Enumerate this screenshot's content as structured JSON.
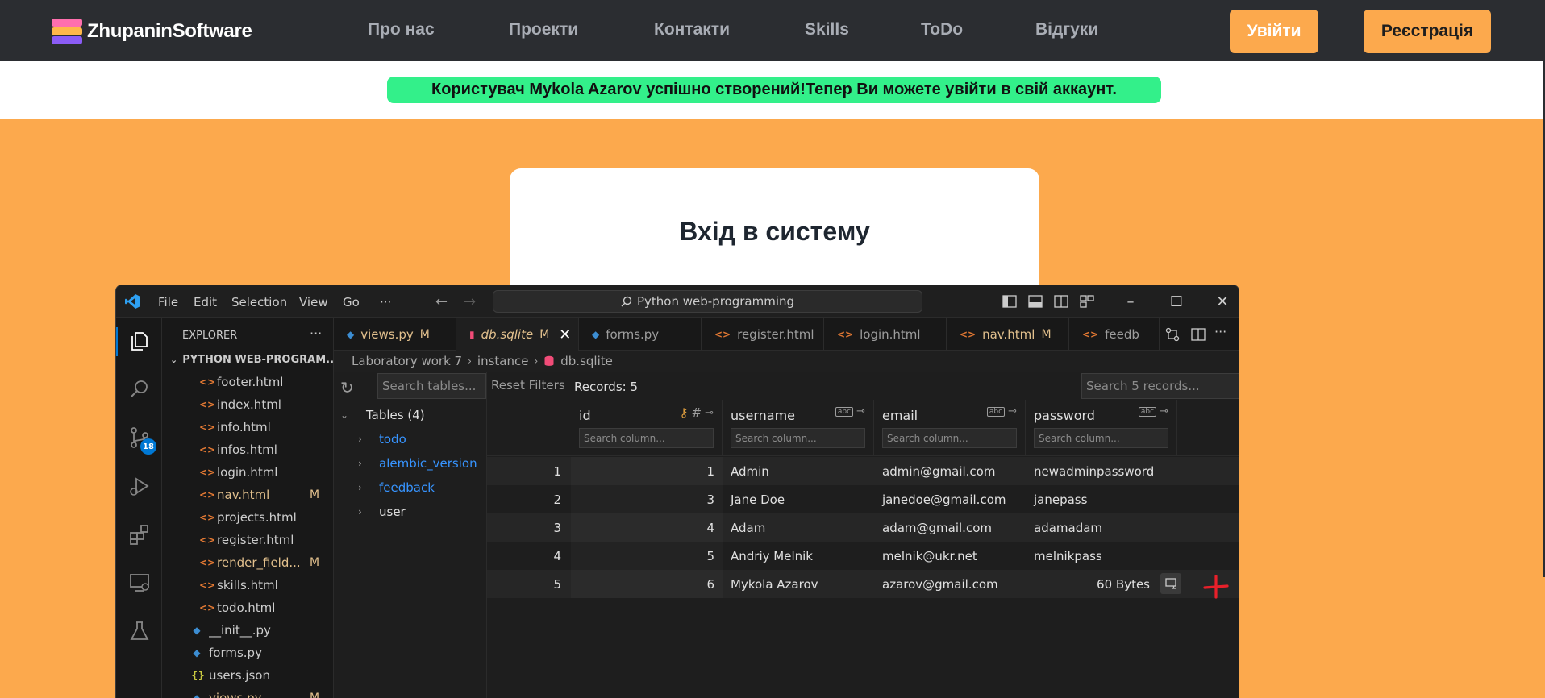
{
  "site": {
    "brand": "ZhupaninSoftware",
    "nav_links": [
      "Про нас",
      "Проекти",
      "Контакти",
      "Skills",
      "ToDo",
      "Відгуки"
    ],
    "login_button": "Увійти",
    "register_button": "Реєстрація",
    "flash_message": "Користувач Mykola Azarov успішно створений!Тепер Ви можете увійти в свій аккаунт.",
    "login_title": "Вхід в систему",
    "colors": {
      "accent": "#fca94d",
      "nav_bg": "#2b2d31",
      "flash_bg": "#33f08a"
    }
  },
  "vscode": {
    "menu": [
      "File",
      "Edit",
      "Selection",
      "View",
      "Go",
      "···"
    ],
    "command_center": "Python web-programming",
    "activity_badge": "18",
    "explorer": {
      "title": "EXPLORER",
      "more": "···",
      "project": "PYTHON WEB-PROGRAM...",
      "files": [
        {
          "name": "footer.html",
          "icon": "html-icon",
          "status": "",
          "modified": false
        },
        {
          "name": "index.html",
          "icon": "html-icon",
          "status": "",
          "modified": false
        },
        {
          "name": "info.html",
          "icon": "html-icon",
          "status": "",
          "modified": false
        },
        {
          "name": "infos.html",
          "icon": "html-icon",
          "status": "",
          "modified": false
        },
        {
          "name": "login.html",
          "icon": "html-icon",
          "status": "",
          "modified": false
        },
        {
          "name": "nav.html",
          "icon": "html-icon",
          "status": "M",
          "modified": true
        },
        {
          "name": "projects.html",
          "icon": "html-icon",
          "status": "",
          "modified": false
        },
        {
          "name": "register.html",
          "icon": "html-icon",
          "status": "",
          "modified": false
        },
        {
          "name": "render_field...",
          "icon": "html-icon",
          "status": "M",
          "modified": true
        },
        {
          "name": "skills.html",
          "icon": "html-icon",
          "status": "",
          "modified": false
        },
        {
          "name": "todo.html",
          "icon": "html-icon",
          "status": "",
          "modified": false
        },
        {
          "name": "__init__.py",
          "icon": "python-icon",
          "status": "",
          "modified": false
        },
        {
          "name": "forms.py",
          "icon": "python-icon",
          "status": "",
          "modified": false
        },
        {
          "name": "users.json",
          "icon": "json-icon",
          "status": "",
          "modified": false
        },
        {
          "name": "views.py",
          "icon": "python-icon",
          "status": "M",
          "modified": true
        }
      ]
    },
    "tabs": [
      {
        "label": "views.py",
        "mark": "M",
        "icon": "python-icon",
        "state": "modified"
      },
      {
        "label": "db.sqlite",
        "mark": "M",
        "icon": "database-icon",
        "state": "active",
        "close": "✕"
      },
      {
        "label": "forms.py",
        "mark": "",
        "icon": "python-icon",
        "state": "normal"
      },
      {
        "label": "register.html",
        "mark": "",
        "icon": "html-icon",
        "state": "normal"
      },
      {
        "label": "login.html",
        "mark": "",
        "icon": "html-icon",
        "state": "normal"
      },
      {
        "label": "nav.html",
        "mark": "M",
        "icon": "html-icon",
        "state": "modified"
      },
      {
        "label": "feedb",
        "mark": "",
        "icon": "html-icon",
        "state": "normal"
      }
    ],
    "breadcrumb": [
      "Laboratory work 7",
      "instance",
      "db.sqlite"
    ],
    "sqlite": {
      "search_tables_placeholder": "Search tables...",
      "tables_header": "Tables (4)",
      "tables": [
        "todo",
        "alembic_version",
        "feedback",
        "user"
      ],
      "reset_filters": "Reset Filters",
      "records": "Records: 5",
      "search_records_placeholder": "Search 5 records...",
      "column_search_placeholder": "Search column...",
      "columns": [
        "id",
        "username",
        "email",
        "password"
      ],
      "rows": [
        {
          "num": "1",
          "id": "1",
          "username": "Admin",
          "email": "admin@gmail.com",
          "password": "newadminpassword"
        },
        {
          "num": "2",
          "id": "3",
          "username": "Jane Doe",
          "email": "janedoe@gmail.com",
          "password": "janepass"
        },
        {
          "num": "3",
          "id": "4",
          "username": "Adam",
          "email": "adam@gmail.com",
          "password": "adamadam"
        },
        {
          "num": "4",
          "id": "5",
          "username": "Andriy Melnik",
          "email": "melnik@ukr.net",
          "password": "melnikpass"
        },
        {
          "num": "5",
          "id": "6",
          "username": "Mykola Azarov",
          "email": "azarov@gmail.com",
          "password": "60 Bytes"
        }
      ]
    }
  }
}
